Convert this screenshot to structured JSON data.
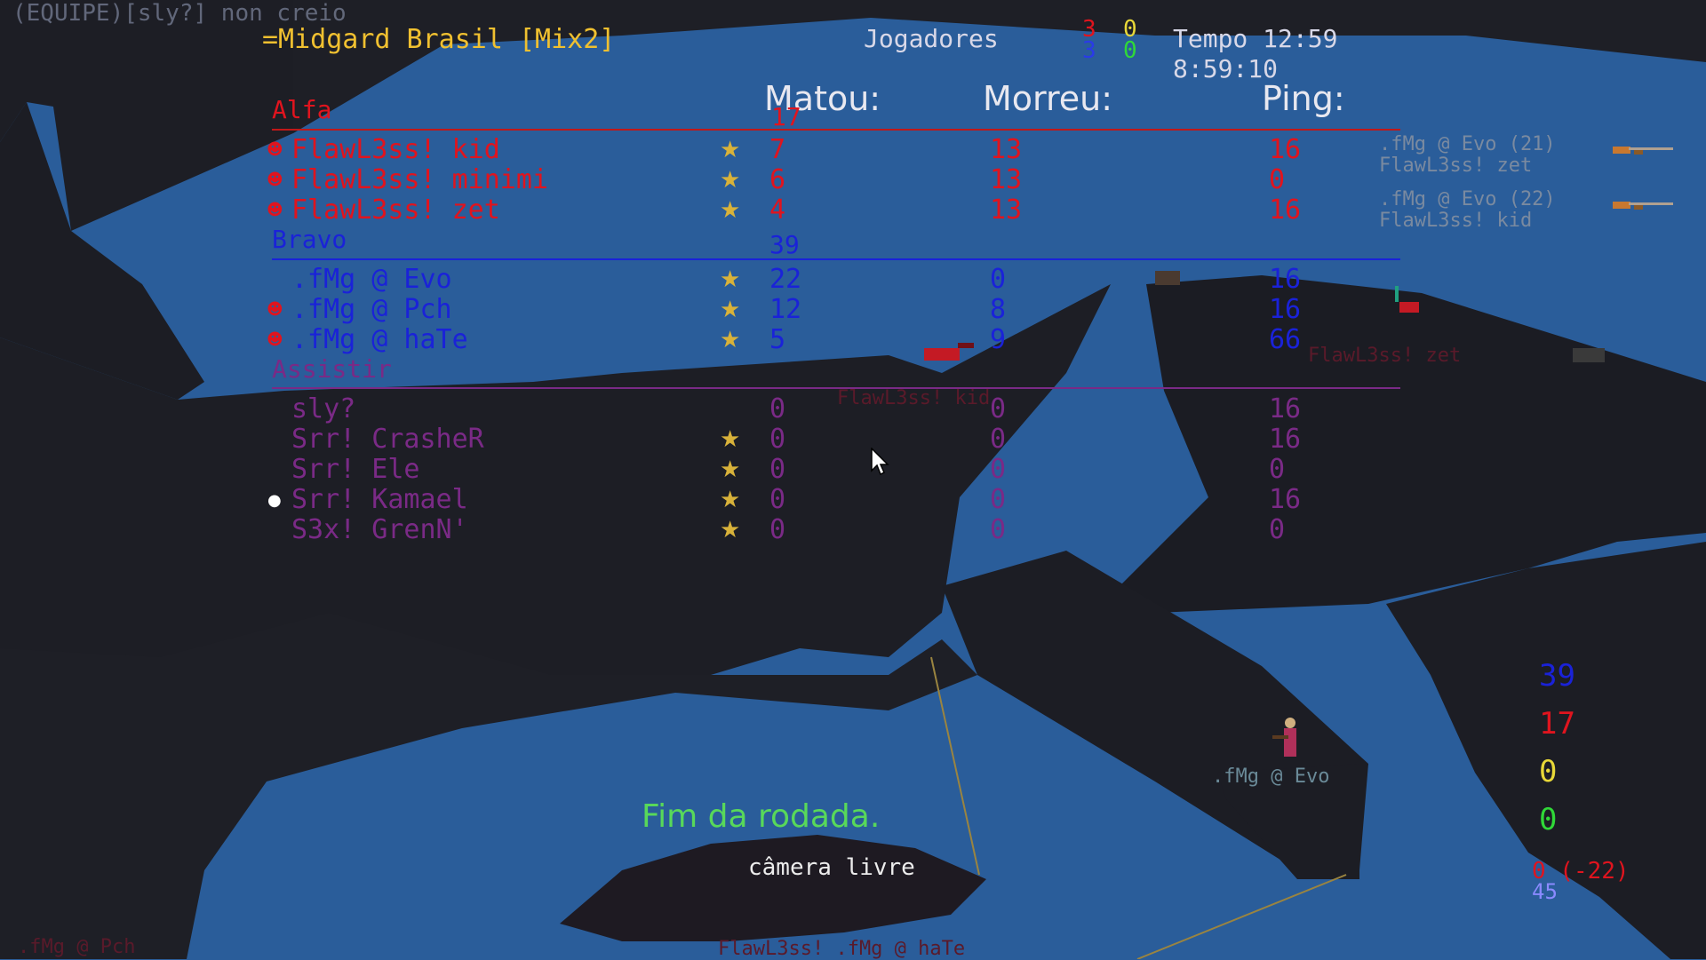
{
  "chat": {
    "message": "(EQUIPE)[sly?] non creio"
  },
  "server": {
    "name": "=Midgard Brasil [Mix2]"
  },
  "players_header": {
    "label": "Jogadores",
    "red_count": "3",
    "yellow_count": "0",
    "blue_count": "3",
    "green_count": "0"
  },
  "time": {
    "tempo": "Tempo 12:59",
    "clock": "8:59:10"
  },
  "columns": {
    "kills": "Matou:",
    "deaths": "Morreu:",
    "ping": "Ping:"
  },
  "teams": {
    "alfa": {
      "name": "Alfa",
      "score": "17",
      "players": [
        {
          "name": "FlawL3ss! kid",
          "kills": "7",
          "deaths": "13",
          "ping": "16",
          "dead": true,
          "star": true
        },
        {
          "name": "FlawL3ss! minimi",
          "kills": "6",
          "deaths": "13",
          "ping": "0",
          "dead": true,
          "star": true
        },
        {
          "name": "FlawL3ss! zet",
          "kills": "4",
          "deaths": "13",
          "ping": "16",
          "dead": true,
          "star": true
        }
      ]
    },
    "bravo": {
      "name": "Bravo",
      "score": "39",
      "players": [
        {
          "name": ".fMg @ Evo",
          "kills": "22",
          "deaths": "0",
          "ping": "16",
          "dead": false,
          "star": true
        },
        {
          "name": ".fMg @ Pch",
          "kills": "12",
          "deaths": "8",
          "ping": "16",
          "dead": true,
          "star": true
        },
        {
          "name": ".fMg @ haTe",
          "kills": "5",
          "deaths": "9",
          "ping": "66",
          "dead": true,
          "star": true
        }
      ]
    },
    "spectators": {
      "name": "Assistir",
      "players": [
        {
          "name": "sly?",
          "kills": "0",
          "deaths": "0",
          "ping": "16",
          "star": false,
          "marker": false
        },
        {
          "name": "Srr! CrasheR",
          "kills": "0",
          "deaths": "0",
          "ping": "16",
          "star": true,
          "marker": false
        },
        {
          "name": "Srr! Ele",
          "kills": "0",
          "deaths": "0",
          "ping": "0",
          "star": true,
          "marker": false
        },
        {
          "name": "Srr! Kamael",
          "kills": "0",
          "deaths": "0",
          "ping": "16",
          "star": true,
          "marker": true
        },
        {
          "name": "S3x! GrenN'",
          "kills": "0",
          "deaths": "0",
          "ping": "0",
          "star": true,
          "marker": false
        }
      ]
    }
  },
  "killfeed": [
    {
      "killer": ".fMg @ Evo (21)",
      "victim": "FlawL3ss! zet",
      "weapon_icon": "rifle-icon"
    },
    {
      "killer": ".fMg @ Evo (22)",
      "victim": "FlawL3ss! kid",
      "weapon_icon": "rifle-icon"
    }
  ],
  "world_labels": {
    "zet": "FlawL3ss! zet",
    "kid": "FlawL3ss! kid",
    "evo": ".fMg @ Evo",
    "pch": ".fMg @ Pch",
    "bottom": "FlawL3ss! .fMg @ haTe"
  },
  "center": {
    "round_end": "Fim da rodada.",
    "camera": "câmera livre"
  },
  "score_panel": {
    "blue": "39",
    "red": "17",
    "yellow": "0",
    "green": "0",
    "ratio": "0 (-22)",
    "extra": "45"
  },
  "colors": {
    "sky": "#2a5d9a",
    "rock": "#1d1e25",
    "alfa": "#e0141e",
    "bravo": "#1a22d8",
    "spectator": "#7a2a86",
    "round_end": "#58d85a"
  }
}
